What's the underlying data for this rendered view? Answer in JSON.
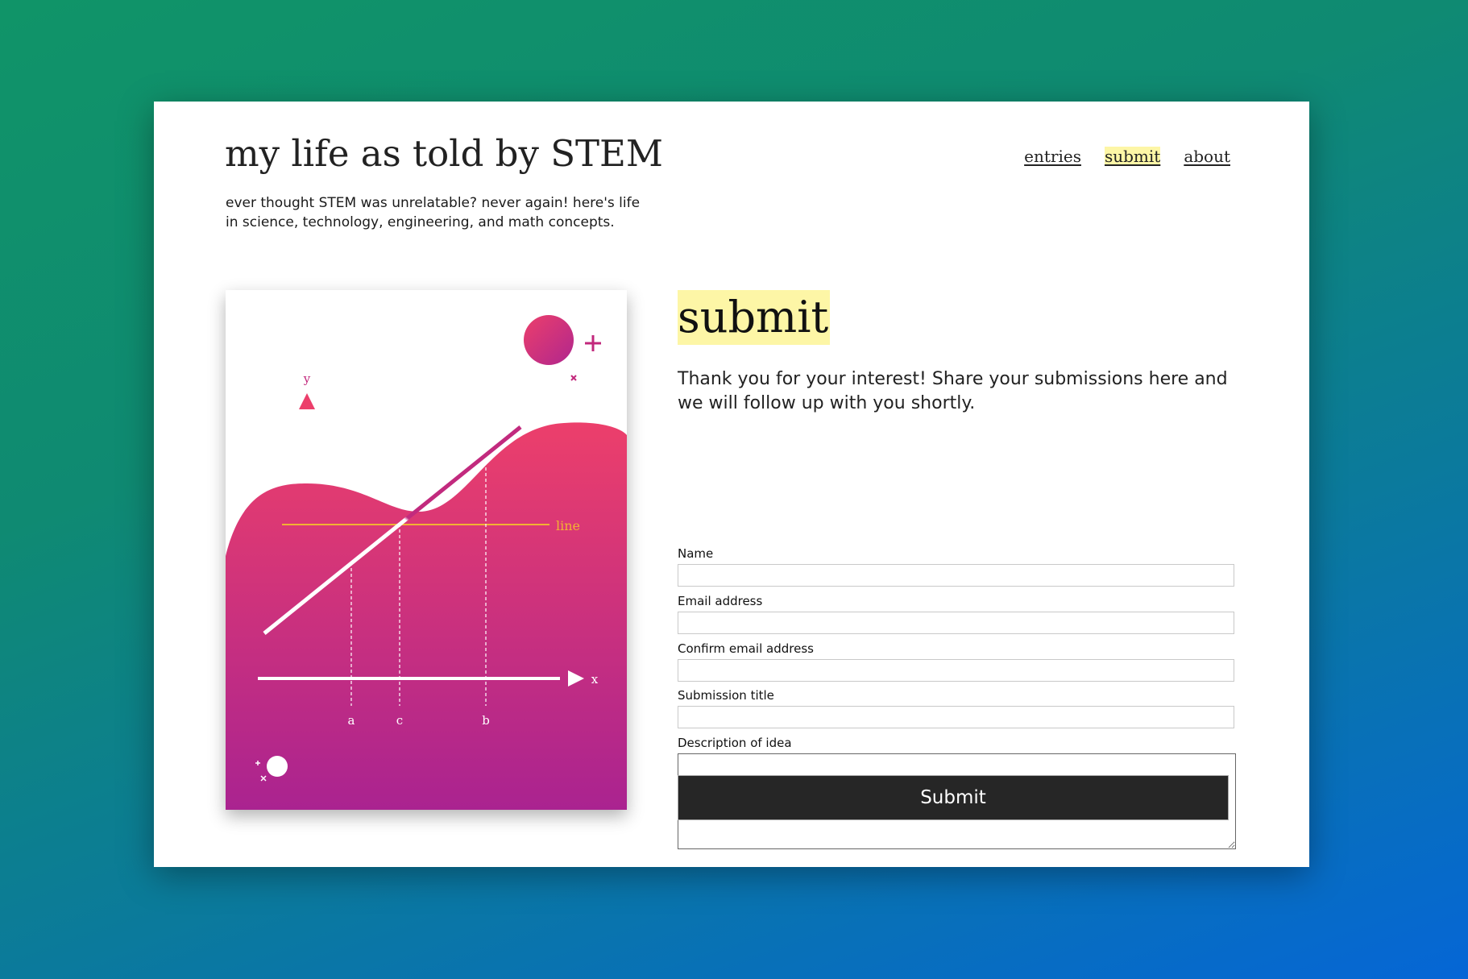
{
  "site": {
    "title": "my life as told by STEM",
    "tagline": "ever thought STEM was unrelatable? never again! here's life in science, technology, engineering, and math concepts."
  },
  "nav": {
    "items": [
      {
        "label": "entries",
        "active": false
      },
      {
        "label": "submit",
        "active": true
      },
      {
        "label": "about",
        "active": false
      }
    ],
    "highlight_color": "#fdf6a6"
  },
  "illustration": {
    "axis_y_label": "y",
    "axis_x_label": "x",
    "line_label": "line",
    "tick_labels": [
      "a",
      "c",
      "b"
    ],
    "gradient_top": "#ec3f6b",
    "gradient_bottom": "#aa2390",
    "line_label_color": "#f2b233"
  },
  "main": {
    "heading": "submit",
    "intro": "Thank you for your interest! Share your submissions here and we will follow up with you shortly.",
    "form": {
      "fields": [
        {
          "label": "Name",
          "value": "",
          "placeholder": ""
        },
        {
          "label": "Email address",
          "value": "",
          "placeholder": ""
        },
        {
          "label": "Confirm email address",
          "value": "",
          "placeholder": ""
        },
        {
          "label": "Submission title",
          "value": "",
          "placeholder": ""
        }
      ],
      "description": {
        "label": "Description of idea",
        "value": "",
        "placeholder": ""
      },
      "submit_label": "Submit"
    }
  },
  "colors": {
    "button_bg": "#262626",
    "button_text": "#ffffff"
  }
}
